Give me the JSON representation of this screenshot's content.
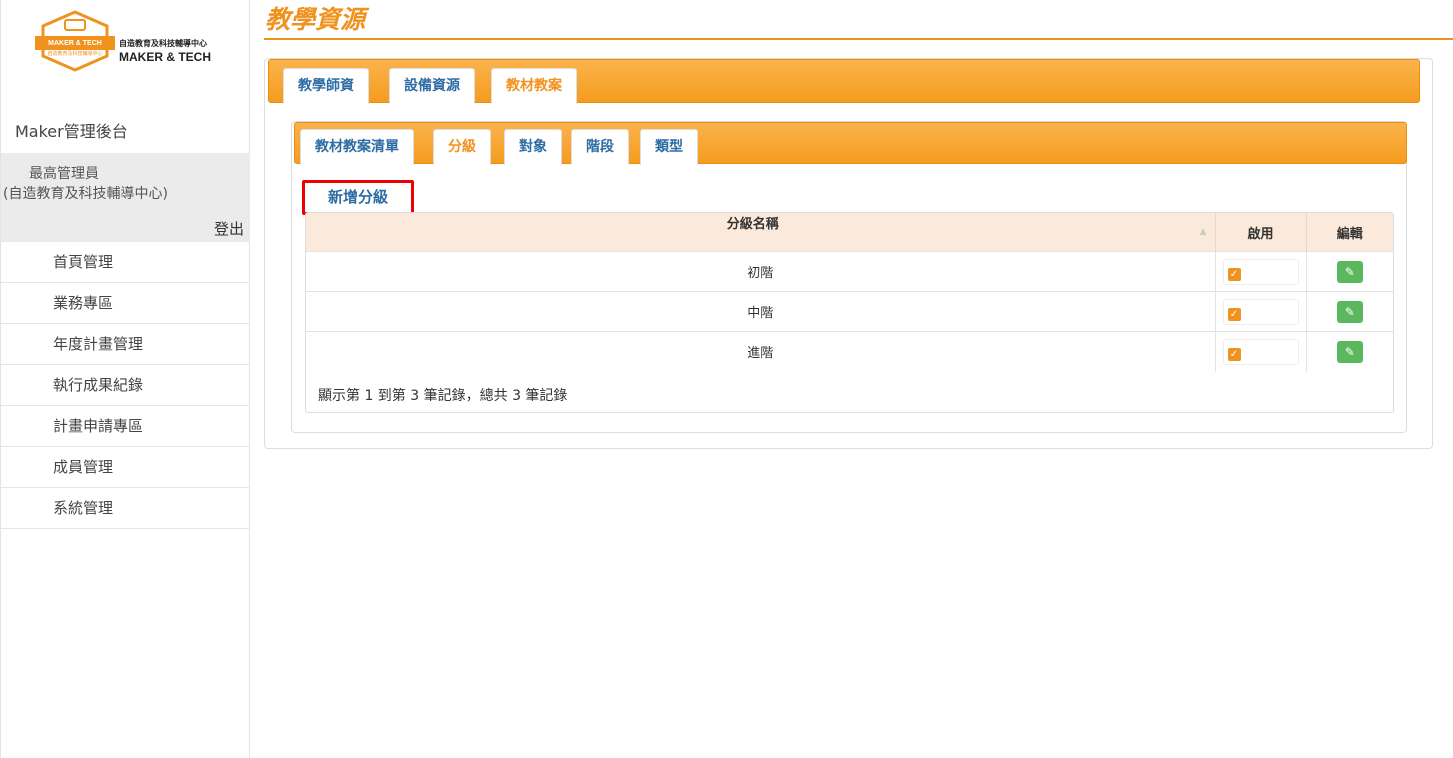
{
  "logo": {
    "line1": "自造教育及科技輔導中心",
    "line2": "MAKER & TECH",
    "badge_text": "MAKER & TECH",
    "badge_sub": "自造教育及科技輔導中心"
  },
  "sidebar": {
    "title": "Maker管理後台",
    "user_name": "最高管理員",
    "user_org": "(自造教育及科技輔導中心)",
    "logout": "登出",
    "items": [
      {
        "label": "首頁管理"
      },
      {
        "label": "業務專區"
      },
      {
        "label": "年度計畫管理"
      },
      {
        "label": "執行成果紀錄"
      },
      {
        "label": "計畫申請專區"
      },
      {
        "label": "成員管理"
      },
      {
        "label": "系統管理"
      }
    ]
  },
  "page": {
    "title": "教學資源"
  },
  "outer_tabs": [
    {
      "label": "教學師資",
      "active": false
    },
    {
      "label": "設備資源",
      "active": false
    },
    {
      "label": "教材教案",
      "active": true
    }
  ],
  "inner_tabs": [
    {
      "label": "教材教案清單",
      "active": false
    },
    {
      "label": "分級",
      "active": true
    },
    {
      "label": "對象",
      "active": false
    },
    {
      "label": "階段",
      "active": false
    },
    {
      "label": "類型",
      "active": false
    }
  ],
  "add_button": "新增分級",
  "table": {
    "headers": [
      "分級名稱",
      "啟用",
      "編輯"
    ],
    "rows": [
      {
        "name": "初階",
        "enabled": true
      },
      {
        "name": "中階",
        "enabled": true
      },
      {
        "name": "進階",
        "enabled": true
      }
    ],
    "footer": "顯示第 1 到第 3 筆記錄，總共 3 筆記錄"
  },
  "colors": {
    "accent": "#f0921e",
    "link": "#2e6da4",
    "highlight": "#e00000",
    "edit": "#5cb85c"
  },
  "icons": {
    "checkbox": "checkmark-icon",
    "edit": "pencil-icon",
    "sort": "sort-icon"
  }
}
